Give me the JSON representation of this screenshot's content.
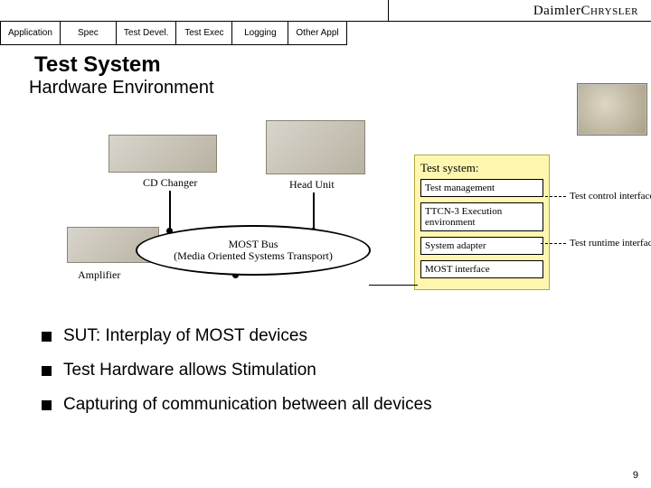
{
  "brand": {
    "first": "Daimler",
    "second": "Chrysler"
  },
  "tabs": [
    "Application",
    "Spec",
    "Test Devel.",
    "Test Exec",
    "Logging",
    "Other Appl"
  ],
  "title": "Test System",
  "subtitle": "Hardware Environment",
  "diagram": {
    "cd_changer_label": "CD Changer",
    "head_unit_label": "Head Unit",
    "amplifier_label": "Amplifier",
    "bus_line1": "MOST Bus",
    "bus_line2": "(Media Oriented Systems Transport)",
    "panel_title": "Test system:",
    "boxes": [
      "Test management",
      "TTCN-3 Execution environment",
      "System adapter",
      "MOST interface"
    ],
    "side_labels": [
      "Test control interface",
      "Test runtime interface"
    ]
  },
  "bullets": [
    "SUT: Interplay of MOST devices",
    "Test Hardware allows Stimulation",
    "Capturing of communication between all devices"
  ],
  "page_number": "9"
}
